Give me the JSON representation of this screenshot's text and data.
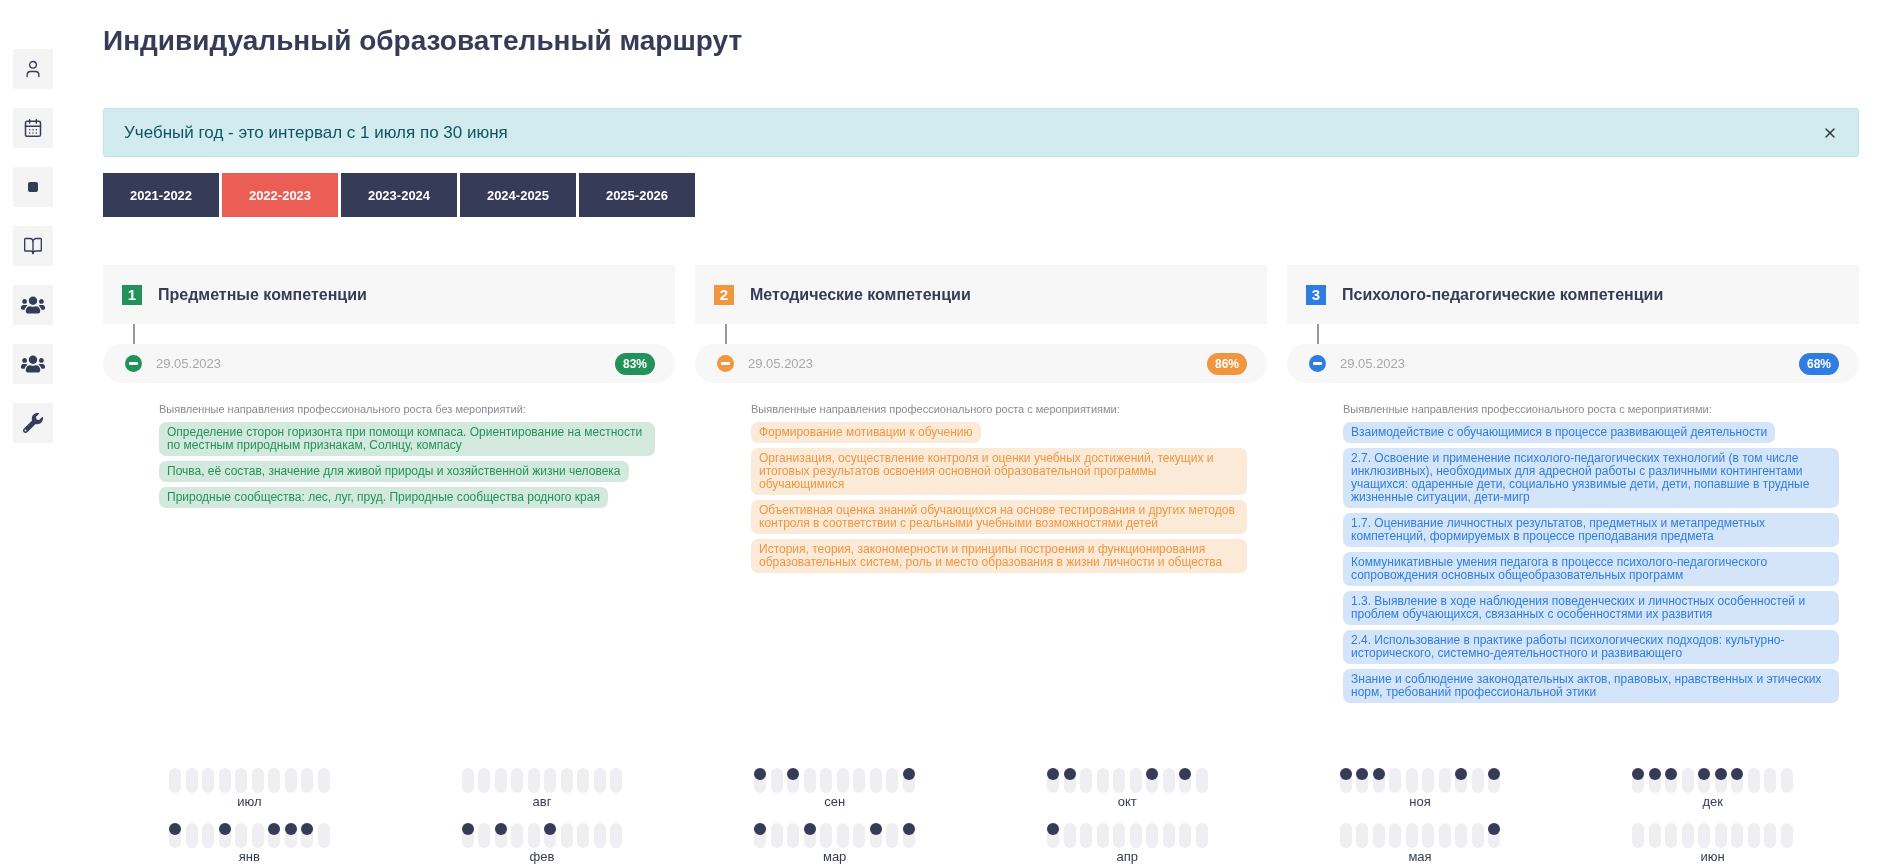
{
  "title": "Индивидуальный образовательный маршрут",
  "alert": {
    "text": "Учебный год - это интервал с 1 июля по 30 июня"
  },
  "years": [
    {
      "label": "2021-2022",
      "selected": false
    },
    {
      "label": "2022-2023",
      "selected": true
    },
    {
      "label": "2023-2024",
      "selected": false
    },
    {
      "label": "2024-2025",
      "selected": false
    },
    {
      "label": "2025-2026",
      "selected": false
    }
  ],
  "competencies": [
    {
      "number": "1",
      "title": "Предметные компетенции",
      "color": "#22925a",
      "date": "29.05.2023",
      "percent": "83%",
      "subtitle": "Выявленные направления профессионального роста без мероприятий:",
      "items": [
        "Определение сторон горизонта при помощи компаса. Ориентирование на местности по местным природным признакам, Солнцу, компасу",
        "Почва, её состав, значение для живой природы и хозяйственной жизни человека",
        "Природные сообщества: лес, луг, пруд. Природные сообщества родного края"
      ]
    },
    {
      "number": "2",
      "title": "Методические компетенции",
      "color": "#f0963e",
      "date": "29.05.2023",
      "percent": "86%",
      "subtitle": "Выявленные направления профессионального роста с мероприятиями:",
      "items": [
        "Формирование мотивации к обучению",
        "Организация, осуществление контроля и оценки учебных достижений, текущих и итоговых результатов освоения основной образовательной программы обучающимися",
        "Объективная оценка знаний обучающихся на основе тестирования и других методов контроля в соответствии с реальными учебными возможностями детей",
        "История, теория, закономерности и принципы построения и функционирования образовательных систем, роль и место образования в жизни личности и общества"
      ]
    },
    {
      "number": "3",
      "title": "Психолого-педагогические компетенции",
      "color": "#2f7de1",
      "date": "29.05.2023",
      "percent": "68%",
      "subtitle": "Выявленные направления профессионального роста с мероприятиями:",
      "items": [
        "Взаимодействие с обучающимися в процессе развивающей деятельности",
        "2.7. Освоение и применение психолого-педагогических технологий (в том числе инклюзивных), необходимых для адресной работы с различными контингентами учащихся: одаренные дети, социально уязвимые дети, дети, попавшие в трудные жизненные ситуации, дети-мигр",
        "1.7. Оценивание личностных результатов, предметных и метапредметных компетенций, формируемых в процессе преподавания предмета",
        "Коммуникативные умения педагога в процессе психолого-педагогического сопровождения основных общеобразовательных программ",
        "1.3. Выявление в ходе наблюдения поведенческих и личностных особенностей и проблем обучающихся, связанных с особенностями их развития",
        "2.4. Использование в практике работы психологических подходов: культурно-исторического, системно-деятельностного и развивающего",
        "Знание и соблюдение законодательных актов, правовых, нравственных и этических норм, требований профессиональной этики"
      ]
    }
  ],
  "calendar": [
    {
      "month": "июл",
      "filled": [
        false,
        false,
        false,
        false,
        false,
        false,
        false,
        false,
        false,
        false
      ]
    },
    {
      "month": "авг",
      "filled": [
        false,
        false,
        false,
        false,
        false,
        false,
        false,
        false,
        false,
        false
      ]
    },
    {
      "month": "сен",
      "filled": [
        true,
        false,
        true,
        false,
        false,
        false,
        false,
        false,
        false,
        true
      ]
    },
    {
      "month": "окт",
      "filled": [
        true,
        true,
        false,
        false,
        false,
        false,
        true,
        false,
        true,
        false
      ]
    },
    {
      "month": "ноя",
      "filled": [
        true,
        true,
        true,
        false,
        false,
        false,
        false,
        true,
        false,
        true
      ]
    },
    {
      "month": "дек",
      "filled": [
        true,
        true,
        true,
        false,
        true,
        true,
        true,
        false,
        false,
        false
      ]
    },
    {
      "month": "янв",
      "filled": [
        true,
        false,
        false,
        true,
        false,
        false,
        true,
        true,
        true,
        false
      ]
    },
    {
      "month": "фев",
      "filled": [
        true,
        false,
        true,
        false,
        false,
        true,
        false,
        false,
        false,
        false
      ]
    },
    {
      "month": "мар",
      "filled": [
        true,
        false,
        false,
        true,
        false,
        false,
        false,
        true,
        false,
        true
      ]
    },
    {
      "month": "апр",
      "filled": [
        true,
        false,
        false,
        false,
        false,
        false,
        false,
        false,
        false,
        false
      ]
    },
    {
      "month": "мая",
      "filled": [
        false,
        false,
        false,
        false,
        false,
        false,
        false,
        false,
        false,
        true
      ]
    },
    {
      "month": "июн",
      "filled": [
        false,
        false,
        false,
        false,
        false,
        false,
        false,
        false,
        false,
        false
      ]
    }
  ]
}
